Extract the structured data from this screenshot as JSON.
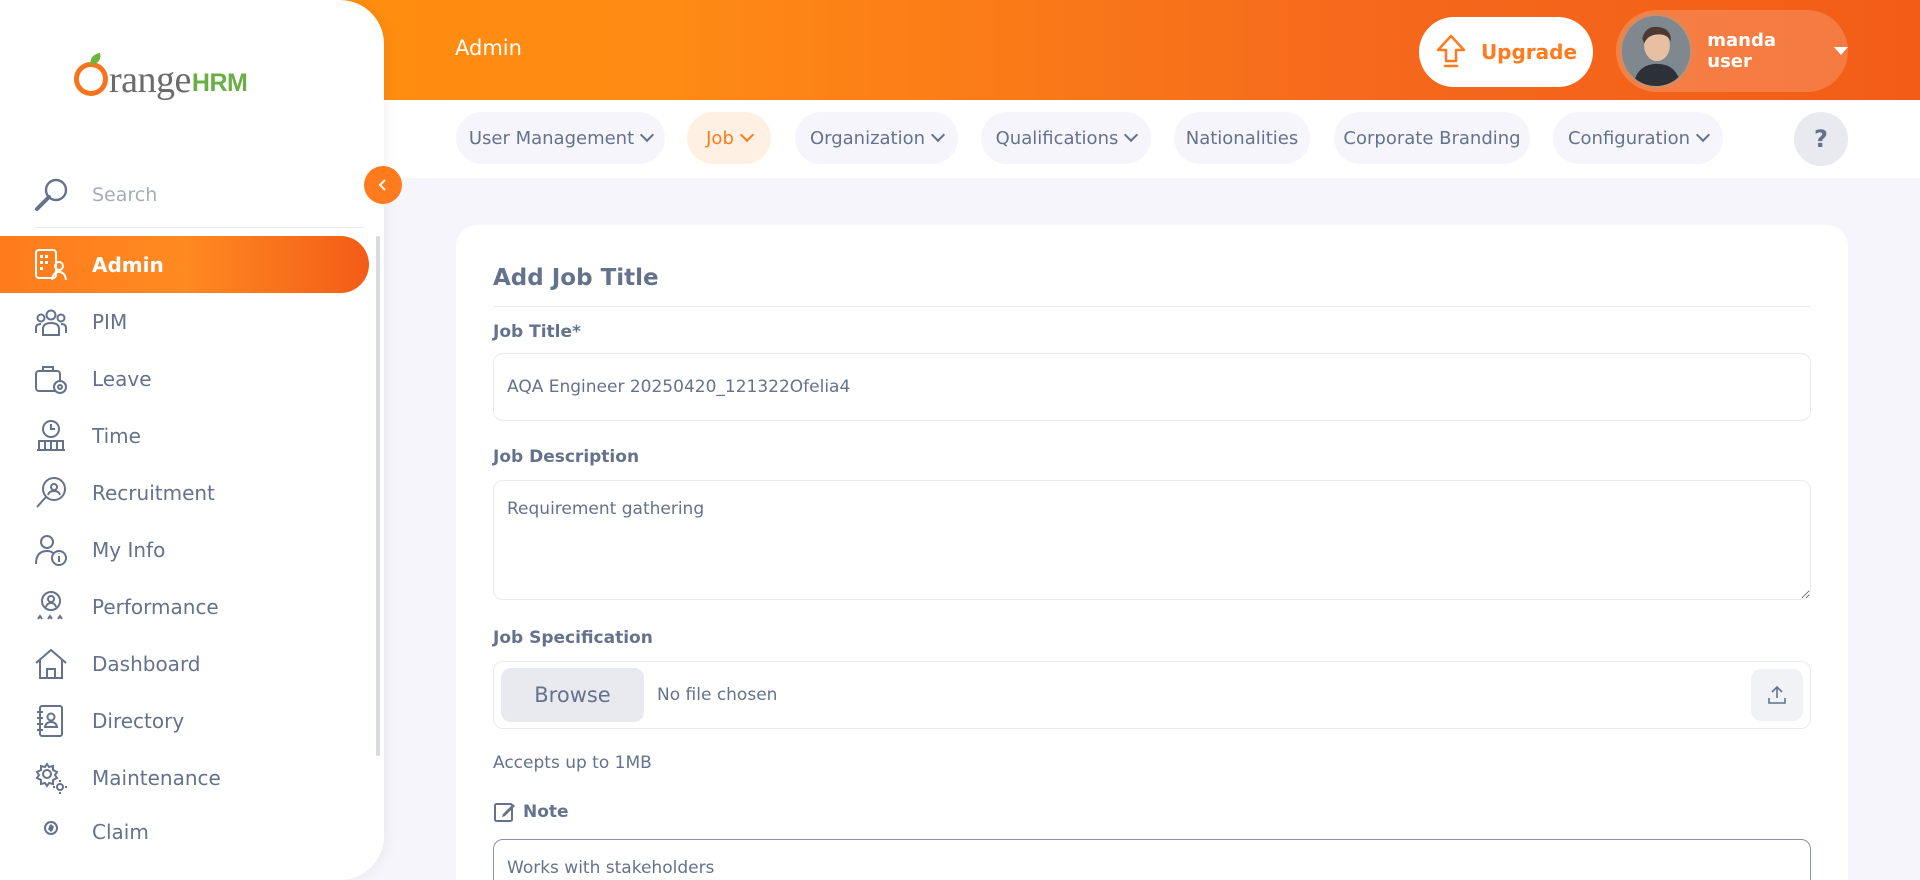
{
  "brand": {
    "name_part1": "range",
    "name_part2": "HRM"
  },
  "sidebar": {
    "search_placeholder": "Search",
    "items": [
      {
        "label": "Admin",
        "icon": "admin-icon",
        "active": true
      },
      {
        "label": "PIM",
        "icon": "pim-icon"
      },
      {
        "label": "Leave",
        "icon": "leave-icon"
      },
      {
        "label": "Time",
        "icon": "time-icon"
      },
      {
        "label": "Recruitment",
        "icon": "recruitment-icon"
      },
      {
        "label": "My Info",
        "icon": "my-info-icon"
      },
      {
        "label": "Performance",
        "icon": "performance-icon"
      },
      {
        "label": "Dashboard",
        "icon": "dashboard-icon"
      },
      {
        "label": "Directory",
        "icon": "directory-icon"
      },
      {
        "label": "Maintenance",
        "icon": "maintenance-icon"
      },
      {
        "label": "Claim",
        "icon": "claim-icon"
      }
    ]
  },
  "header": {
    "module_title": "Admin",
    "upgrade_label": "Upgrade",
    "user_name": "manda user"
  },
  "subnav": {
    "tabs": [
      {
        "label": "User Management",
        "has_dropdown": true
      },
      {
        "label": "Job",
        "has_dropdown": true,
        "active": true
      },
      {
        "label": "Organization",
        "has_dropdown": true
      },
      {
        "label": "Qualifications",
        "has_dropdown": true
      },
      {
        "label": "Nationalities",
        "has_dropdown": false
      },
      {
        "label": "Corporate Branding",
        "has_dropdown": false
      },
      {
        "label": "Configuration",
        "has_dropdown": true
      }
    ],
    "help_label": "?"
  },
  "form": {
    "title": "Add Job Title",
    "job_title_label": "Job Title*",
    "job_title_value": "AQA Engineer 20250420_121322Ofelia4",
    "job_description_label": "Job Description",
    "job_description_value": "Requirement gathering",
    "job_spec_label": "Job Specification",
    "browse_label": "Browse",
    "file_status": "No file chosen",
    "file_hint": "Accepts up to 1MB",
    "note_label": "Note",
    "note_value": "Works with stakeholders"
  },
  "colors": {
    "accent": "#ff7b1d",
    "header_start": "#ff920b",
    "header_end": "#f35c17",
    "text": "#64728c",
    "background": "#f6f5fb"
  }
}
